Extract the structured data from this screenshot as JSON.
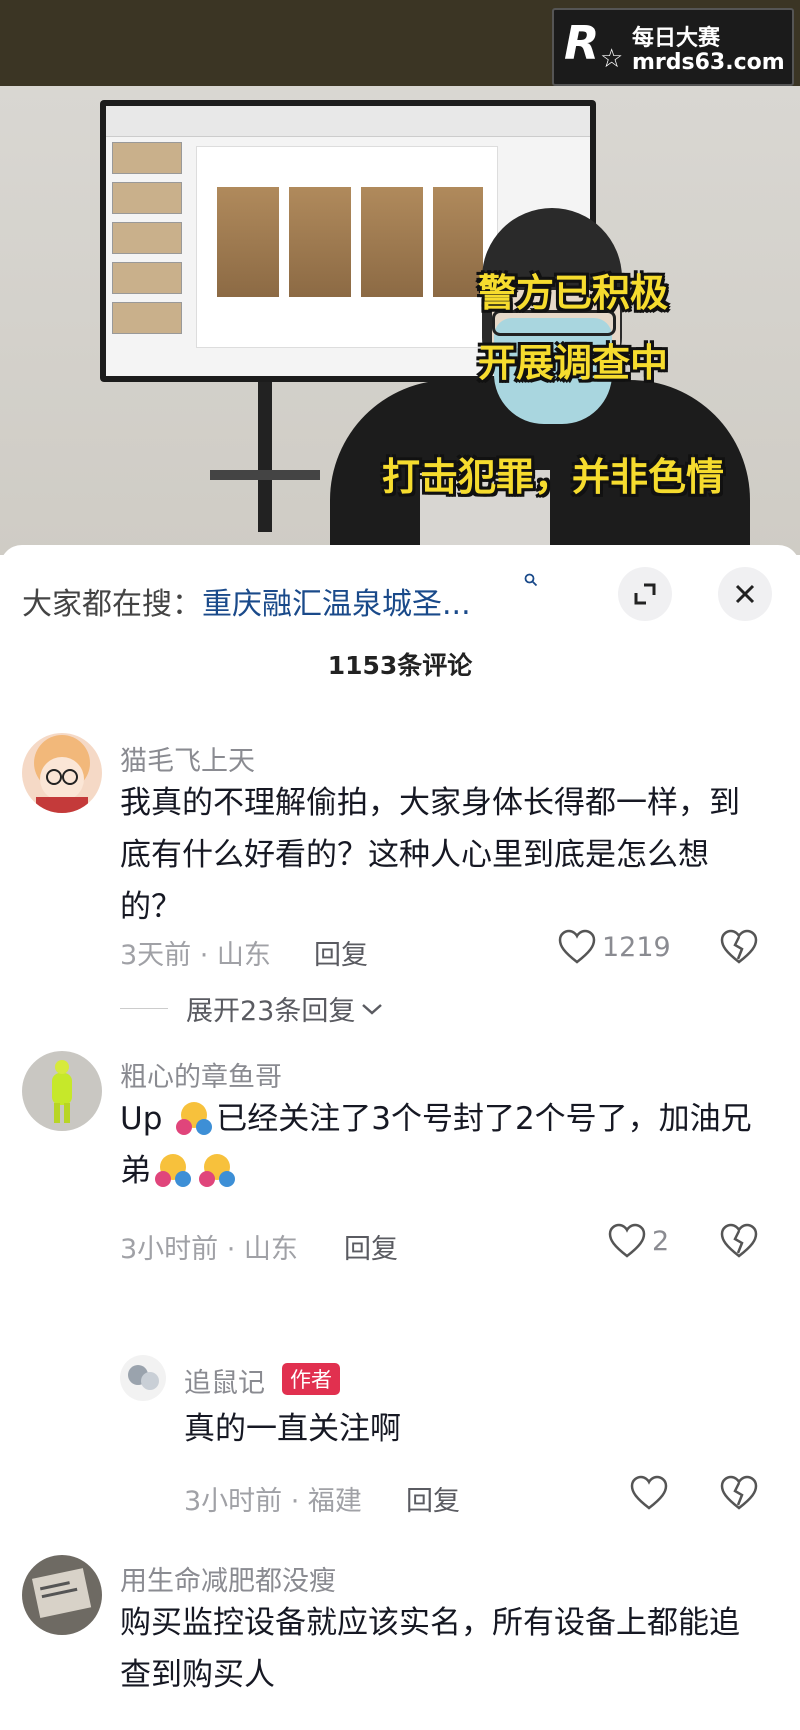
{
  "watermark": {
    "mark": "R",
    "line1": "每日大赛",
    "line2": "mrds63.com"
  },
  "video": {
    "subtitles": [
      "警方已积极",
      "开展调查中",
      "打击犯罪，并非色情"
    ]
  },
  "search": {
    "prefix": "大家都在搜：",
    "term": "重庆融汇温泉城圣..."
  },
  "comment_count": "1153条评论",
  "comments": [
    {
      "user": "猫毛飞上天",
      "text": "我真的不理解偷拍，大家身体长得都一样，到底有什么好看的？这种人心里到底是怎么想的？",
      "meta": "3天前 · 山东",
      "reply": "回复",
      "likes": "1219",
      "expand": "展开23条回复"
    },
    {
      "user": "粗心的章鱼哥",
      "text_a": "Up ",
      "text_b": "已经关注了3个号封了2个号了，加油兄弟",
      "meta": "3小时前 · 山东",
      "reply": "回复",
      "likes": "2"
    },
    {
      "user": "追鼠记",
      "badge": "作者",
      "text": "真的一直关注啊",
      "meta": "3小时前 · 福建",
      "reply": "回复"
    },
    {
      "user": "用生命减肥都没瘦",
      "text": "购买监控设备就应该实名，所有设备上都能追查到购买人"
    }
  ]
}
